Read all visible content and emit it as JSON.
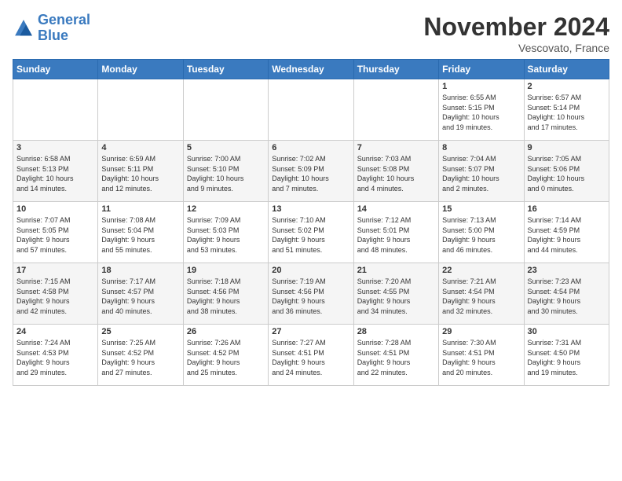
{
  "logo": {
    "line1": "General",
    "line2": "Blue"
  },
  "title": "November 2024",
  "location": "Vescovato, France",
  "days_header": [
    "Sunday",
    "Monday",
    "Tuesday",
    "Wednesday",
    "Thursday",
    "Friday",
    "Saturday"
  ],
  "weeks": [
    [
      {
        "day": "",
        "info": ""
      },
      {
        "day": "",
        "info": ""
      },
      {
        "day": "",
        "info": ""
      },
      {
        "day": "",
        "info": ""
      },
      {
        "day": "",
        "info": ""
      },
      {
        "day": "1",
        "info": "Sunrise: 6:55 AM\nSunset: 5:15 PM\nDaylight: 10 hours\nand 19 minutes."
      },
      {
        "day": "2",
        "info": "Sunrise: 6:57 AM\nSunset: 5:14 PM\nDaylight: 10 hours\nand 17 minutes."
      }
    ],
    [
      {
        "day": "3",
        "info": "Sunrise: 6:58 AM\nSunset: 5:13 PM\nDaylight: 10 hours\nand 14 minutes."
      },
      {
        "day": "4",
        "info": "Sunrise: 6:59 AM\nSunset: 5:11 PM\nDaylight: 10 hours\nand 12 minutes."
      },
      {
        "day": "5",
        "info": "Sunrise: 7:00 AM\nSunset: 5:10 PM\nDaylight: 10 hours\nand 9 minutes."
      },
      {
        "day": "6",
        "info": "Sunrise: 7:02 AM\nSunset: 5:09 PM\nDaylight: 10 hours\nand 7 minutes."
      },
      {
        "day": "7",
        "info": "Sunrise: 7:03 AM\nSunset: 5:08 PM\nDaylight: 10 hours\nand 4 minutes."
      },
      {
        "day": "8",
        "info": "Sunrise: 7:04 AM\nSunset: 5:07 PM\nDaylight: 10 hours\nand 2 minutes."
      },
      {
        "day": "9",
        "info": "Sunrise: 7:05 AM\nSunset: 5:06 PM\nDaylight: 10 hours\nand 0 minutes."
      }
    ],
    [
      {
        "day": "10",
        "info": "Sunrise: 7:07 AM\nSunset: 5:05 PM\nDaylight: 9 hours\nand 57 minutes."
      },
      {
        "day": "11",
        "info": "Sunrise: 7:08 AM\nSunset: 5:04 PM\nDaylight: 9 hours\nand 55 minutes."
      },
      {
        "day": "12",
        "info": "Sunrise: 7:09 AM\nSunset: 5:03 PM\nDaylight: 9 hours\nand 53 minutes."
      },
      {
        "day": "13",
        "info": "Sunrise: 7:10 AM\nSunset: 5:02 PM\nDaylight: 9 hours\nand 51 minutes."
      },
      {
        "day": "14",
        "info": "Sunrise: 7:12 AM\nSunset: 5:01 PM\nDaylight: 9 hours\nand 48 minutes."
      },
      {
        "day": "15",
        "info": "Sunrise: 7:13 AM\nSunset: 5:00 PM\nDaylight: 9 hours\nand 46 minutes."
      },
      {
        "day": "16",
        "info": "Sunrise: 7:14 AM\nSunset: 4:59 PM\nDaylight: 9 hours\nand 44 minutes."
      }
    ],
    [
      {
        "day": "17",
        "info": "Sunrise: 7:15 AM\nSunset: 4:58 PM\nDaylight: 9 hours\nand 42 minutes."
      },
      {
        "day": "18",
        "info": "Sunrise: 7:17 AM\nSunset: 4:57 PM\nDaylight: 9 hours\nand 40 minutes."
      },
      {
        "day": "19",
        "info": "Sunrise: 7:18 AM\nSunset: 4:56 PM\nDaylight: 9 hours\nand 38 minutes."
      },
      {
        "day": "20",
        "info": "Sunrise: 7:19 AM\nSunset: 4:56 PM\nDaylight: 9 hours\nand 36 minutes."
      },
      {
        "day": "21",
        "info": "Sunrise: 7:20 AM\nSunset: 4:55 PM\nDaylight: 9 hours\nand 34 minutes."
      },
      {
        "day": "22",
        "info": "Sunrise: 7:21 AM\nSunset: 4:54 PM\nDaylight: 9 hours\nand 32 minutes."
      },
      {
        "day": "23",
        "info": "Sunrise: 7:23 AM\nSunset: 4:54 PM\nDaylight: 9 hours\nand 30 minutes."
      }
    ],
    [
      {
        "day": "24",
        "info": "Sunrise: 7:24 AM\nSunset: 4:53 PM\nDaylight: 9 hours\nand 29 minutes."
      },
      {
        "day": "25",
        "info": "Sunrise: 7:25 AM\nSunset: 4:52 PM\nDaylight: 9 hours\nand 27 minutes."
      },
      {
        "day": "26",
        "info": "Sunrise: 7:26 AM\nSunset: 4:52 PM\nDaylight: 9 hours\nand 25 minutes."
      },
      {
        "day": "27",
        "info": "Sunrise: 7:27 AM\nSunset: 4:51 PM\nDaylight: 9 hours\nand 24 minutes."
      },
      {
        "day": "28",
        "info": "Sunrise: 7:28 AM\nSunset: 4:51 PM\nDaylight: 9 hours\nand 22 minutes."
      },
      {
        "day": "29",
        "info": "Sunrise: 7:30 AM\nSunset: 4:51 PM\nDaylight: 9 hours\nand 20 minutes."
      },
      {
        "day": "30",
        "info": "Sunrise: 7:31 AM\nSunset: 4:50 PM\nDaylight: 9 hours\nand 19 minutes."
      }
    ]
  ]
}
